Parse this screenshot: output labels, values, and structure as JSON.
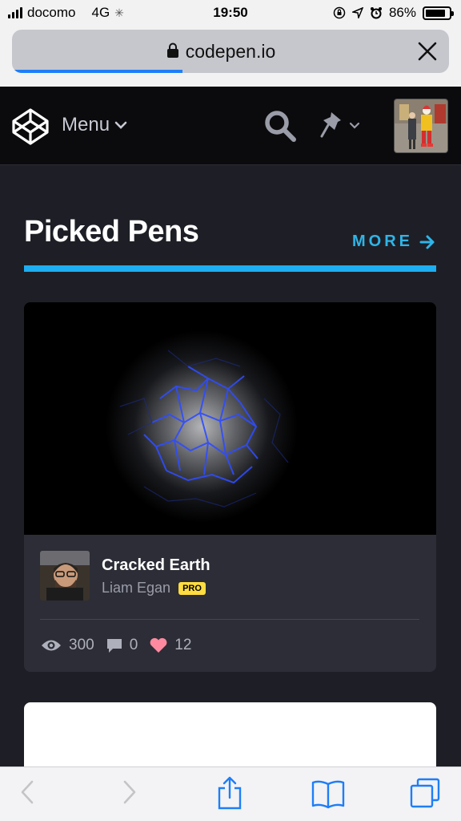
{
  "status_bar": {
    "carrier": "docomo",
    "network": "4G",
    "time": "19:50",
    "battery": "86%",
    "battery_level": 0.86
  },
  "browser": {
    "url": "codepen.io",
    "load_progress": 0.39
  },
  "header": {
    "menu_label": "Menu",
    "icons": [
      "codepen-logo-icon",
      "search-icon",
      "pin-icon",
      "avatar"
    ]
  },
  "section": {
    "title": "Picked Pens",
    "more_label": "MORE"
  },
  "pen": {
    "title": "Cracked Earth",
    "author": "Liam Egan",
    "badge": "PRO",
    "views": "300",
    "comments": "0",
    "likes": "12"
  },
  "colors": {
    "accent_blue": "#1dadf0",
    "like_pink": "#ff8aa0",
    "pro_yellow": "#ffdd40"
  }
}
